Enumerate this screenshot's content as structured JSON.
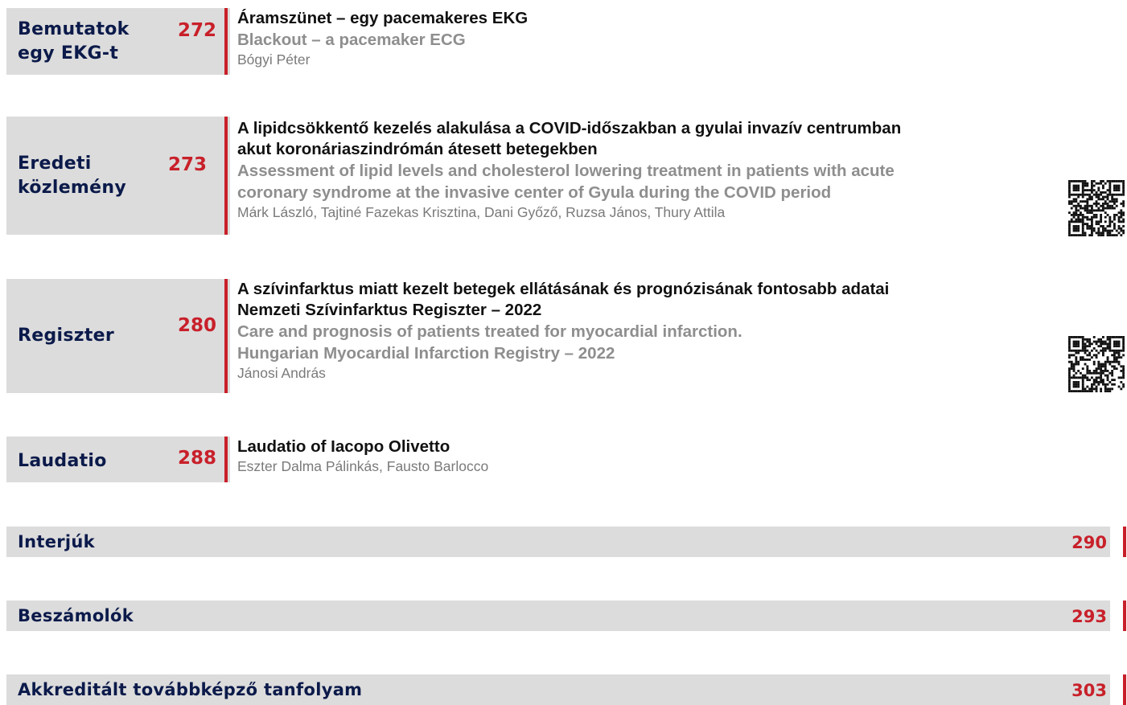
{
  "colors": {
    "section_bg": "#dcdcdc",
    "section_label": "#0b1a4a",
    "accent_red": "#c8202a",
    "english_title": "#8e8e8e",
    "authors": "#7a7a7a"
  },
  "sections": [
    {
      "label_lines": [
        "Bemutatok",
        "egy EKG-t"
      ],
      "page": "272",
      "title_hu": [
        "Áramszünet – egy pacemakeres EKG"
      ],
      "title_en": [
        "Blackout – a pacemaker ECG"
      ],
      "authors": "Bógyi Péter",
      "qr": false
    },
    {
      "label_lines": [
        "Eredeti",
        "közlemény"
      ],
      "page": "273",
      "title_hu": [
        "A lipidcsökkentő kezelés alakulása a COVID-időszakban a gyulai invazív centrumban",
        "akut koronáriaszindrómán átesett betegekben"
      ],
      "title_en": [
        "Assessment of lipid levels and cholesterol lowering treatment in patients with acute",
        "coronary syndrome at the invasive center of Gyula during the COVID period"
      ],
      "authors": "Márk László, Tajtiné Fazekas Krisztina, Dani Győző, Ruzsa János, Thury Attila",
      "qr": true
    },
    {
      "label_lines": [
        "Regiszter"
      ],
      "page": "280",
      "title_hu": [
        "A szívinfarktus miatt kezelt betegek ellátásának és prognózisának fontosabb adatai",
        "Nemzeti Szívinfarktus Regiszter – 2022"
      ],
      "title_en": [
        "Care and prognosis of patients treated for myocardial infarction.",
        "Hungarian Myocardial Infarction Registry – 2022"
      ],
      "authors": "Jánosi András",
      "qr": true
    },
    {
      "label_lines": [
        "Laudatio"
      ],
      "page": "288",
      "title_hu": [
        "Laudatio of Iacopo Olivetto"
      ],
      "title_en": [],
      "authors": "Eszter Dalma Pálinkás, Fausto Barlocco",
      "qr": false
    }
  ],
  "wide_sections": [
    {
      "label": "Interjúk",
      "page": "290"
    },
    {
      "label": "Beszámolók",
      "page": "293"
    },
    {
      "label": "Akkreditált továbbképző tanfolyam",
      "page": "303"
    }
  ],
  "icons": {
    "qr": "qr-code-icon"
  }
}
